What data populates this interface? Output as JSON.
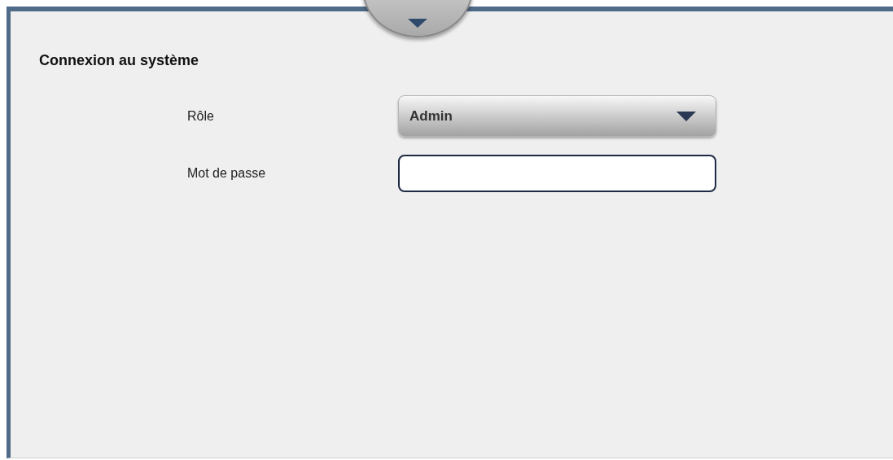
{
  "title": "Connexion au système",
  "fields": [
    {
      "kind": "select",
      "label": "Rôle",
      "value": "Admin"
    },
    {
      "kind": "password",
      "label": "Mot de passe"
    }
  ]
}
